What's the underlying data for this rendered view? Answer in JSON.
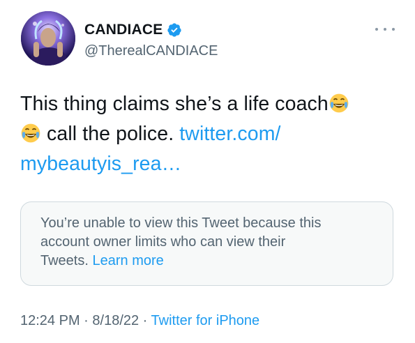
{
  "author": {
    "display_name": "CANDIACE",
    "handle": "@TherealCANDIACE",
    "verified": true
  },
  "tweet": {
    "line1_text": "This thing claims she’s a life coach",
    "line2_text": " call the police. ",
    "link_part1": "twitter.com/",
    "link_part2": "mybeautyis_rea…",
    "emoji_name": "face-with-tears-of-joy"
  },
  "quoted": {
    "line1": "You’re unable to view this Tweet because this",
    "line2": "account owner limits who can view their",
    "line3_text": "Tweets. ",
    "learn_more": "Learn more"
  },
  "meta": {
    "time": "12:24 PM",
    "sep1": " · ",
    "date": "8/18/22",
    "sep2": " · ",
    "source": "Twitter for iPhone"
  },
  "colors": {
    "link": "#1d9bf0",
    "secondary_text": "#536471",
    "verified_badge": "#1d9bf0"
  }
}
